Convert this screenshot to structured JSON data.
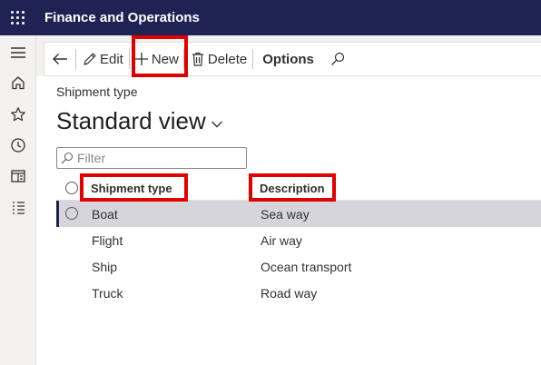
{
  "app": {
    "title": "Finance and Operations"
  },
  "navpane": {
    "items": [
      "hamburger-menu",
      "home",
      "favorites",
      "recent",
      "workspaces",
      "modules"
    ]
  },
  "toolbar": {
    "edit_label": "Edit",
    "new_label": "New",
    "delete_label": "Delete",
    "options_label": "Options"
  },
  "page": {
    "entity_label": "Shipment type",
    "view_name": "Standard view",
    "filter_placeholder": "Filter"
  },
  "grid": {
    "columns": [
      "Shipment type",
      "Description"
    ],
    "rows": [
      {
        "shipment_type": "Boat",
        "description": "Sea way",
        "selected": true
      },
      {
        "shipment_type": "Flight",
        "description": "Air way",
        "selected": false
      },
      {
        "shipment_type": "Ship",
        "description": "Ocean transport",
        "selected": false
      },
      {
        "shipment_type": "Truck",
        "description": "Road way",
        "selected": false
      }
    ]
  },
  "colors": {
    "topbar": "#1f2353",
    "highlight": "#e00000",
    "selected_row": "#d6d5db"
  }
}
